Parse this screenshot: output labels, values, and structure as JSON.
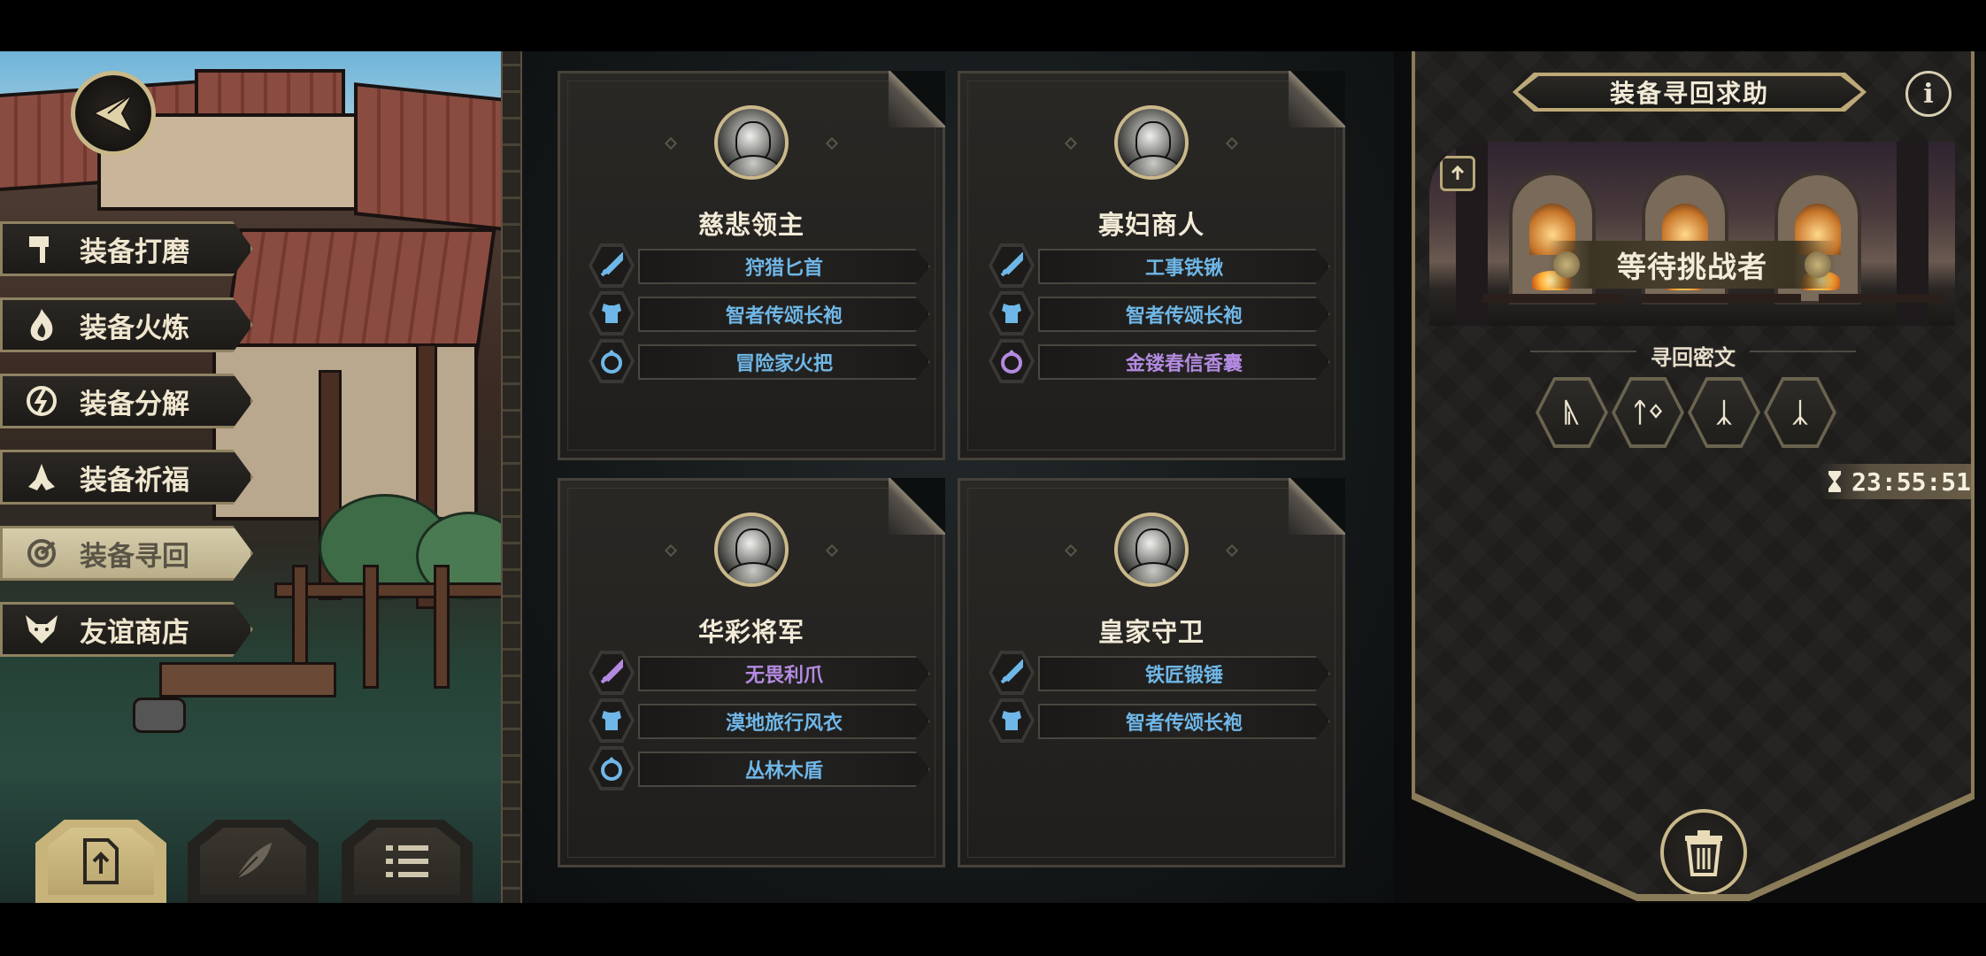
{
  "left_menu": {
    "items": [
      {
        "label": "装备打磨",
        "icon": "hammer-icon",
        "active": false
      },
      {
        "label": "装备火炼",
        "icon": "flame-icon",
        "active": false
      },
      {
        "label": "装备分解",
        "icon": "disassemble-icon",
        "active": false
      },
      {
        "label": "装备祈福",
        "icon": "praying-hands-icon",
        "active": false
      },
      {
        "label": "装备寻回",
        "icon": "target-icon",
        "active": true
      },
      {
        "label": "友谊商店",
        "icon": "fox-icon",
        "active": false
      }
    ]
  },
  "bottom_tabs": [
    {
      "icon": "upload-doc-icon",
      "active": true
    },
    {
      "icon": "feather-icon",
      "active": false
    },
    {
      "icon": "list-icon",
      "active": false
    }
  ],
  "cards": [
    {
      "name": "慈悲领主",
      "items": [
        {
          "label": "狩猎匕首",
          "icon": "sword-icon",
          "rarity": "blue"
        },
        {
          "label": "智者传颂长袍",
          "icon": "armor-icon",
          "rarity": "blue"
        },
        {
          "label": "冒险家火把",
          "icon": "ring-icon",
          "rarity": "blue"
        }
      ]
    },
    {
      "name": "寡妇商人",
      "items": [
        {
          "label": "工事铁锹",
          "icon": "sword-icon",
          "rarity": "blue"
        },
        {
          "label": "智者传颂长袍",
          "icon": "armor-icon",
          "rarity": "blue"
        },
        {
          "label": "金镂春信香囊",
          "icon": "ring-icon",
          "rarity": "purple"
        }
      ]
    },
    {
      "name": "华彩将军",
      "items": [
        {
          "label": "无畏利爪",
          "icon": "sword-icon",
          "rarity": "purple"
        },
        {
          "label": "漠地旅行风衣",
          "icon": "armor-icon",
          "rarity": "blue"
        },
        {
          "label": "丛林木盾",
          "icon": "ring-icon",
          "rarity": "blue"
        }
      ]
    },
    {
      "name": "皇家守卫",
      "items": [
        {
          "label": "铁匠锻锤",
          "icon": "sword-icon",
          "rarity": "blue"
        },
        {
          "label": "智者传颂长袍",
          "icon": "armor-icon",
          "rarity": "blue"
        }
      ]
    }
  ],
  "right_panel": {
    "title": "装备寻回求助",
    "status": "等待挑战者",
    "cipher_label": "寻回密文",
    "cipher_glyphs": [
      "ᚣ",
      "ᛏᛜ",
      "ᛣ",
      "ᛣ"
    ],
    "timer": "23:55:51"
  },
  "colors": {
    "blue_item": "#6fb7e8",
    "purple_item": "#b38ae0",
    "gold_accent": "#c9b88a"
  }
}
